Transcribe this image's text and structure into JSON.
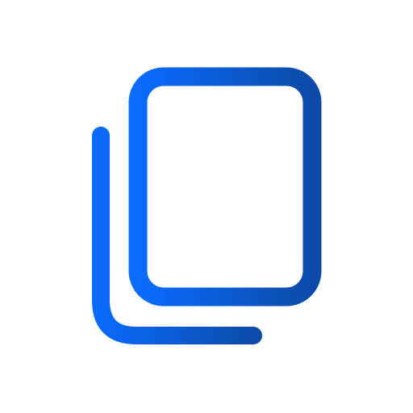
{
  "icon": {
    "name": "copy-icon",
    "description_name": "copy",
    "colors": {
      "background": "#ffffff",
      "gradient_start": "#0a6cff",
      "gradient_end": "#0b4aa8"
    }
  }
}
